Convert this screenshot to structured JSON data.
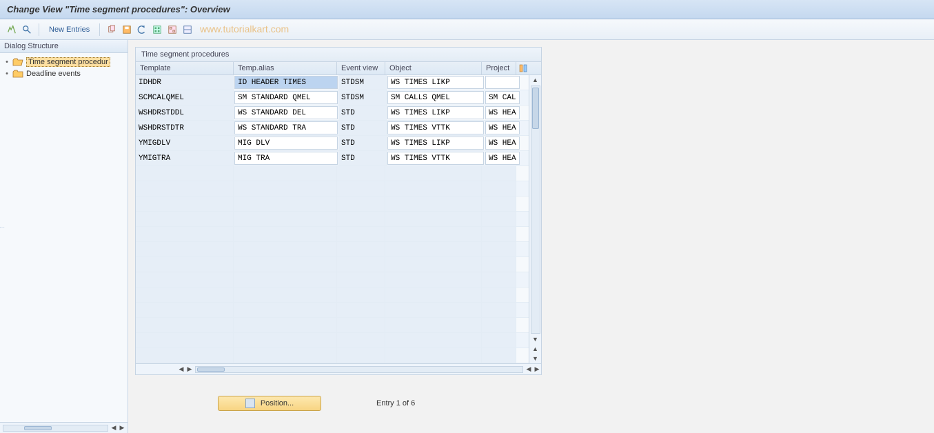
{
  "titlebar": {
    "title": "Change View \"Time segment procedures\": Overview"
  },
  "toolbar": {
    "new_entries": "New Entries"
  },
  "watermark": "www.tutorialkart.com",
  "left": {
    "header": "Dialog Structure",
    "items": [
      {
        "label": "Time segment procedur",
        "selected": true,
        "open": true
      },
      {
        "label": "Deadline events",
        "selected": false,
        "open": false
      }
    ]
  },
  "grid": {
    "caption": "Time segment procedures",
    "columns": [
      "Template",
      "Temp.alias",
      "Event view",
      "Object",
      "Project"
    ],
    "rows": [
      {
        "template": "IDHDR",
        "alias": "ID HEADER TIMES",
        "event": "STDSM",
        "object": "WS TIMES LIKP",
        "project": ""
      },
      {
        "template": "SCMCALQMEL",
        "alias": "SM STANDARD     QMEL",
        "event": "STDSM",
        "object": "SM CALLS QMEL",
        "project": "SM CAL"
      },
      {
        "template": "WSHDRSTDDL",
        "alias": "WS STANDARD DEL",
        "event": "STD",
        "object": "WS TIMES LIKP",
        "project": "WS HEA"
      },
      {
        "template": "WSHDRSTDTR",
        "alias": "WS STANDARD TRA",
        "event": "STD",
        "object": "WS TIMES VTTK",
        "project": "WS HEA"
      },
      {
        "template": "YMIGDLV",
        "alias": "MIG DLV",
        "event": "STD",
        "object": "WS TIMES LIKP",
        "project": "WS HEA"
      },
      {
        "template": "YMIGTRA",
        "alias": "MIG TRA",
        "event": "STD",
        "object": "WS TIMES VTTK",
        "project": "WS HEA"
      }
    ],
    "empty_rows": 13
  },
  "footer": {
    "position_label": "Position...",
    "entry_text": "Entry 1 of 6"
  }
}
